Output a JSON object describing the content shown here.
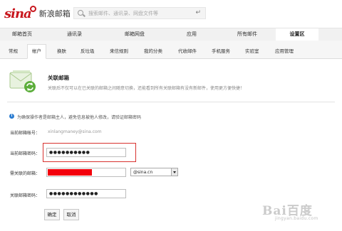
{
  "header": {
    "logo_mark": "sina",
    "logo_text": "新浪邮箱",
    "search_placeholder": "搜索邮件、通讯录、网盘文件等",
    "enter_glyph": "↵"
  },
  "main_nav": {
    "tabs": [
      {
        "label": "邮箱首页",
        "active": false
      },
      {
        "label": "通讯录",
        "active": false
      },
      {
        "label": "邮箱网盘",
        "active": false
      },
      {
        "label": "应用",
        "active": false
      },
      {
        "label": "所有邮件",
        "active": false
      },
      {
        "label": "设置区",
        "active": true
      }
    ]
  },
  "sub_nav": {
    "tabs": [
      {
        "label": "常规",
        "active": false
      },
      {
        "label": "帐户",
        "active": true
      },
      {
        "label": "换肤",
        "active": false
      },
      {
        "label": "反垃圾",
        "active": false
      },
      {
        "label": "来信规则",
        "active": false
      },
      {
        "label": "我的分类",
        "active": false
      },
      {
        "label": "代收邮件",
        "active": false
      },
      {
        "label": "手机服务",
        "active": false
      },
      {
        "label": "实验室",
        "active": false
      },
      {
        "label": "应用管理",
        "active": false
      }
    ]
  },
  "section": {
    "title": "关联邮箱",
    "description": "关联后不仅可以在已关联的邮箱之间随意切换，还能看到所有关联邮箱有没有新邮件，使用更方便快捷！",
    "icon": "envelope-refresh-icon"
  },
  "notice": {
    "icon": "info-icon",
    "text": "为确保操作者是邮箱主人，避免信息被他人修改，请验证邮箱密码"
  },
  "form": {
    "current_account_label": "当前邮箱帐号：",
    "current_account_value": "xinlangmaney@sina.com",
    "current_password_label": "当前邮箱密码：",
    "current_password_value": "●●●●●●●●●●",
    "linked_email_label": "需关联的邮箱：",
    "domain_value": "@sina.cn",
    "linked_password_label": "关联邮箱密码：",
    "linked_password_value": "●●●●●●●●●●●●",
    "highlight_color": "#d8322f",
    "redaction_color": "#f3000c"
  },
  "buttons": {
    "confirm": "确定",
    "cancel": "取消"
  },
  "watermark": {
    "logo": "Bai百度",
    "sub": "jingyan.baidu.com"
  }
}
